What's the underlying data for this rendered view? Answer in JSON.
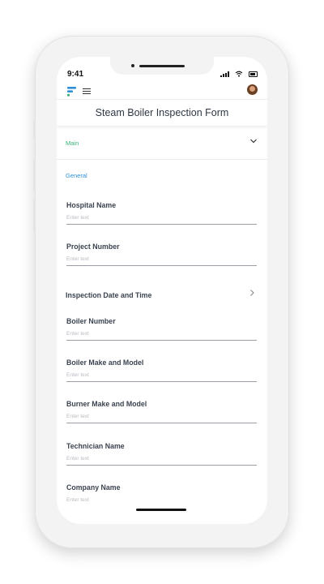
{
  "status": {
    "time": "9:41"
  },
  "header": {
    "title": "Steam Boiler Inspection Form"
  },
  "section": {
    "label": "Main"
  },
  "group": {
    "label": "General"
  },
  "fields": [
    {
      "label": "Hospital Name",
      "placeholder": "Enter text"
    },
    {
      "label": "Project Number",
      "placeholder": "Enter text"
    },
    {
      "label": "Boiler Number",
      "placeholder": "Enter text"
    },
    {
      "label": "Boiler Make and Model",
      "placeholder": "Enter text"
    },
    {
      "label": "Burner Make and Model",
      "placeholder": "Enter text"
    },
    {
      "label": "Technician Name",
      "placeholder": "Enter text"
    },
    {
      "label": "Company Name",
      "placeholder": "Enter text"
    }
  ],
  "inspection": {
    "label": "Inspection Date and Time"
  },
  "colors": {
    "section_accent": "#3bb07a",
    "group_accent": "#2e8fd6",
    "logo_blue": "#2e8fd6",
    "logo_green": "#3bb07a"
  },
  "icons": [
    "logo-icon",
    "menu-icon",
    "avatar",
    "chevron-down-icon",
    "chevron-right-icon",
    "signal-icon",
    "wifi-icon",
    "battery-icon"
  ]
}
